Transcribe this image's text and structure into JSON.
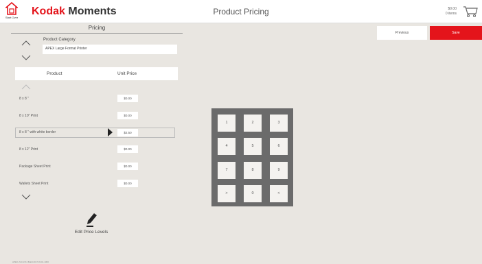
{
  "header": {
    "start_over_label": "Start Over",
    "brand_kodak": "Kodak",
    "brand_moments": "Moments",
    "title": "Product Pricing",
    "cart_total": "$0.00",
    "cart_items": "0 items"
  },
  "pricing": {
    "section_title": "Pricing",
    "category_label": "Product Category",
    "category_value": "APEX Large Format Printer",
    "col_product": "Product",
    "col_unit_price": "Unit Price",
    "rows": [
      {
        "name": "8 x 8 \"",
        "price": "$0.00"
      },
      {
        "name": "8 x 10\" Print",
        "price": "$0.00"
      },
      {
        "name": "8 x 8 \" with white border",
        "price": "$2.50"
      },
      {
        "name": "8 x 12\" Print",
        "price": "$0.00"
      },
      {
        "name": "Package Sheet Print",
        "price": "$0.00"
      },
      {
        "name": "Wallets Sheet Print",
        "price": "$0.00"
      }
    ],
    "edit_price_levels": "Edit Price Levels"
  },
  "actions": {
    "previous": "Previous",
    "save": "Save"
  },
  "keypad": {
    "keys": [
      "1",
      "2",
      "3",
      "4",
      "5",
      "6",
      "7",
      "8",
      "9",
      ">",
      "0",
      "<"
    ]
  },
  "footer": {
    "version": "APEX v9.0.1714 Build 2017.03.01.1300"
  },
  "colors": {
    "accent": "#e4141b",
    "background": "#e9e6e1",
    "keypad_bg": "#6b6b6b"
  }
}
